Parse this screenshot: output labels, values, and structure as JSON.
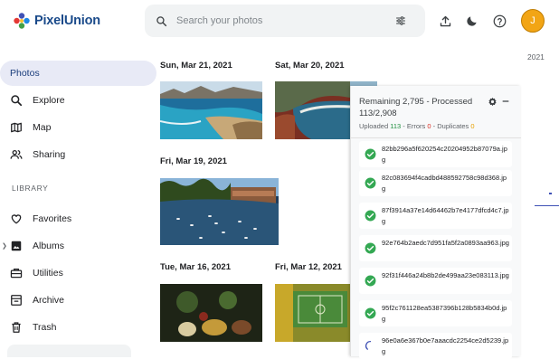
{
  "app": {
    "name": "PixelUnion"
  },
  "search": {
    "placeholder": "Search your photos"
  },
  "user": {
    "initial": "J"
  },
  "sidebar": {
    "items": [
      {
        "label": "Photos",
        "icon": "photos",
        "active": true
      },
      {
        "label": "Explore",
        "icon": "search-icon"
      },
      {
        "label": "Map",
        "icon": "map-icon"
      },
      {
        "label": "Sharing",
        "icon": "people-icon"
      }
    ],
    "library_label": "LIBRARY",
    "library_items": [
      {
        "label": "Favorites",
        "icon": "heart-icon"
      },
      {
        "label": "Albums",
        "icon": "album-icon"
      },
      {
        "label": "Utilities",
        "icon": "toolbox-icon"
      },
      {
        "label": "Archive",
        "icon": "archive-icon"
      },
      {
        "label": "Trash",
        "icon": "trash-icon"
      }
    ]
  },
  "timeline": {
    "year": "2021",
    "dates": [
      "Sun, Mar 21, 2021",
      "Sat, Mar 20, 2021",
      "Fri, Mar 19, 2021",
      "Tue, Mar 16, 2021",
      "Fri, Mar 12, 2021"
    ]
  },
  "upload": {
    "title": "Remaining 2,795 - Processed 113/2,908",
    "uploaded_label": "Uploaded",
    "uploaded": "113",
    "errors_label": "Errors",
    "errors": "0",
    "duplicates_label": "Duplicates",
    "duplicates": "0",
    "files": [
      {
        "name": "82bb296a5f620254c20204952b87079a.jpg",
        "status": "done"
      },
      {
        "name": "82c083694f4cadbd488592758c98d368.jpg",
        "status": "done"
      },
      {
        "name": "87f3914a37e14d64462b7e4177dfcd4c7.jpg",
        "status": "done"
      },
      {
        "name": "92e764b2aedc7d951fa5f2a0893aa963.jpg",
        "status": "done"
      },
      {
        "name": "92f31f446a24b8b2de499aa23e083113.jpg",
        "status": "done"
      },
      {
        "name": "95f2c761128ea5387396b128b5834b0d.jpg",
        "status": "done"
      },
      {
        "name": "96e0a6e367b0e7aaacdc2254ce2d5239.jpg",
        "status": "uploading"
      }
    ]
  },
  "colors": {
    "accent": "#3f51b5",
    "success": "#34a853",
    "error": "#d93025",
    "warning": "#e8a000"
  }
}
